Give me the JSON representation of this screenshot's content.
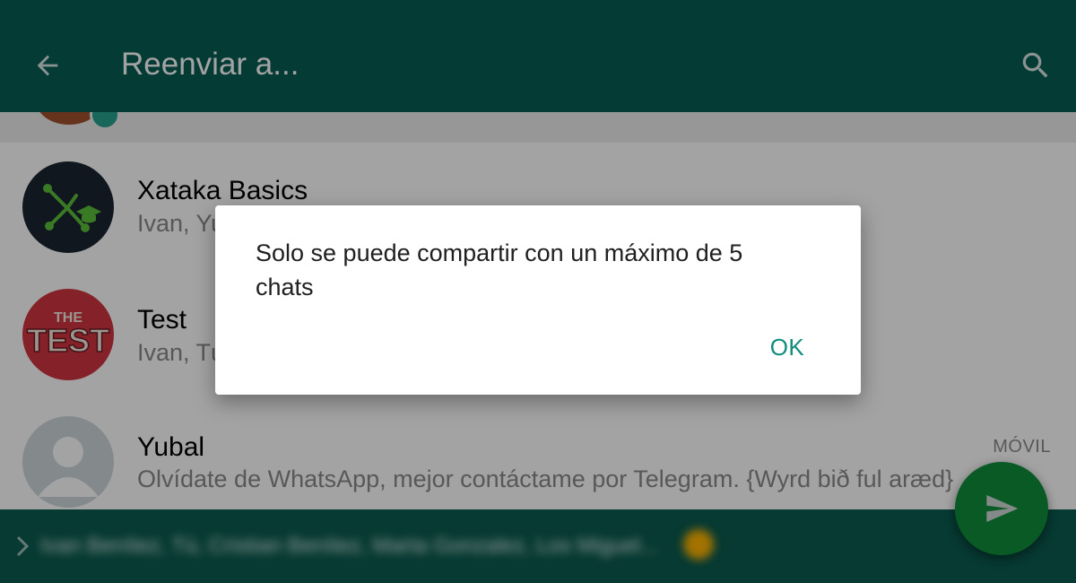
{
  "header": {
    "title": "Reenviar a...",
    "back_icon": "arrow-left-icon",
    "search_icon": "search-icon"
  },
  "chats": [
    {
      "name": "Xataka Basics",
      "subtitle": "Ivan, Yu",
      "avatar_icon": "xataka-basics-logo-icon",
      "tag": ""
    },
    {
      "name": "Test",
      "subtitle": "Ivan, Tú",
      "avatar_icon": "the-test-logo-icon",
      "tag": ""
    },
    {
      "name": "Yubal",
      "subtitle": "Olvídate de WhatsApp, mejor contáctame por Telegram. {Wyrd bið ful aræd}",
      "avatar_icon": "default-avatar-icon",
      "tag": "MÓVIL"
    }
  ],
  "dialog": {
    "message": "Solo se puede compartir con un máximo de 5 chats",
    "ok_label": "OK"
  },
  "bottom_bar": {
    "chevron_icon": "chevron-right-icon",
    "selected_recipients_blurred": "Ivan Benítez, Tú, Cristian Benítez, Marta Gonzalez, Los Miguel..."
  },
  "fab": {
    "icon": "send-icon"
  },
  "colors": {
    "header": "#075e54",
    "bottom_bar": "#0a5b4f",
    "fab": "#0f8d3b",
    "accent_text": "#128c7e"
  }
}
